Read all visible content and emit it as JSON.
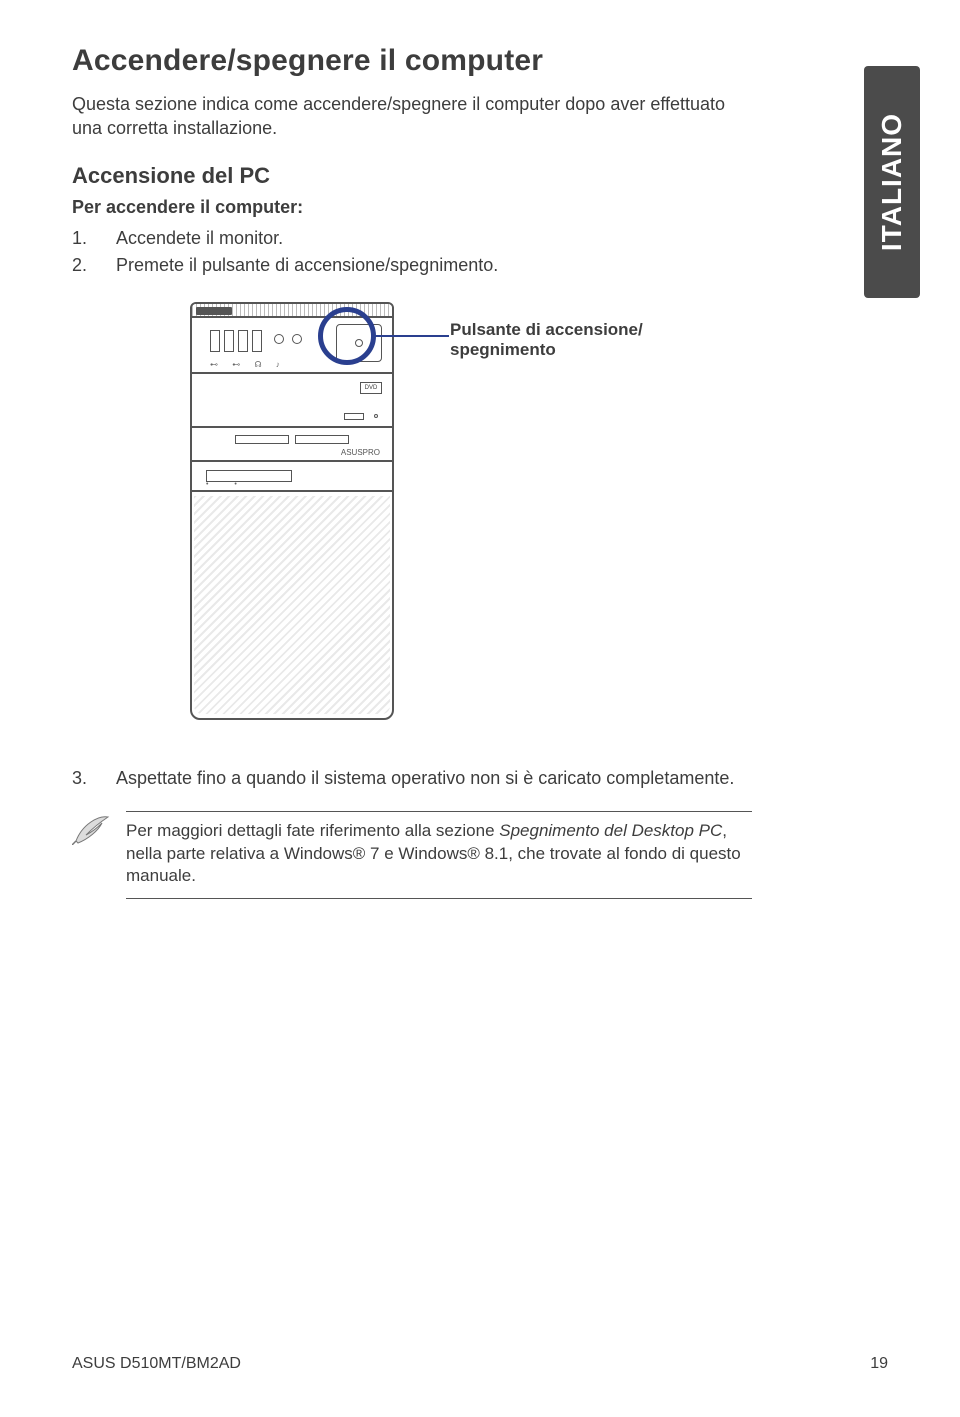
{
  "title": "Accendere/spegnere il computer",
  "intro": "Questa sezione indica come accendere/spegnere il computer dopo aver effettuato una corretta installazione.",
  "section2": "Accensione del PC",
  "sub": "Per accendere il computer:",
  "steps": {
    "n1": "1.",
    "t1": "Accendete il monitor.",
    "n2": "2.",
    "t2": "Premete il pulsante di accensione/spegnimento.",
    "n3": "3.",
    "t3": "Aspettate fino a quando il sistema operativo non si è caricato completamente."
  },
  "callout": "Pulsante di accensione/ spegnimento",
  "language_tab": "ITALIANO",
  "note": {
    "pre": "Per maggiori dettagli fate riferimento alla sezione ",
    "ital": "Spegnimento del Desktop PC",
    "post": ", nella parte relativa a Windows® 7 e Windows® 8.1, che trovate al fondo di questo manuale."
  },
  "case_labels": {
    "dvd": "DVD",
    "brand": "ASUSPRO"
  },
  "footer": {
    "model": "ASUS D510MT/BM2AD",
    "page": "19"
  }
}
